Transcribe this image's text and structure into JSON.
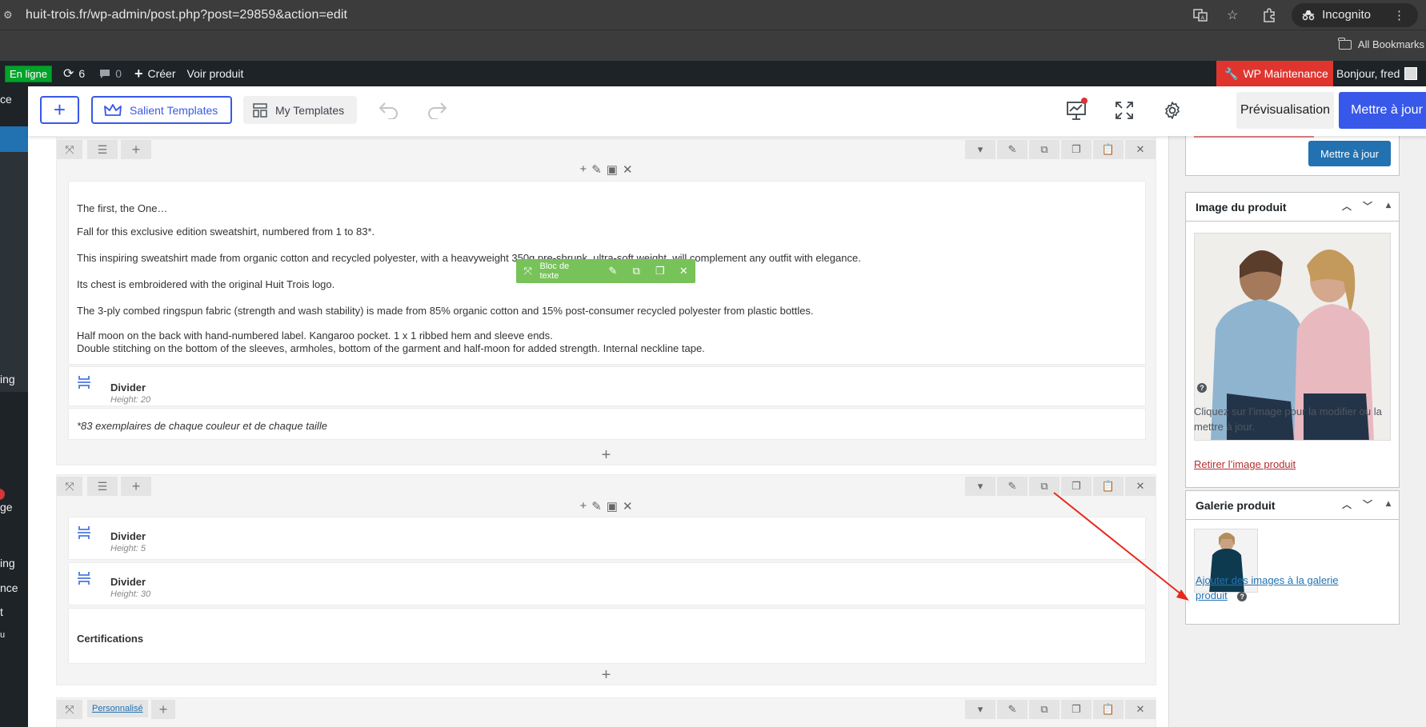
{
  "browser": {
    "url": "huit-trois.fr/wp-admin/post.php?post=29859&action=edit",
    "incognito_label": "Incognito",
    "bookmarks_label": "All Bookmarks"
  },
  "adminbar": {
    "status": "En ligne",
    "updates_count": "6",
    "comments_count": "0",
    "create_label": "Créer",
    "view_label": "Voir produit",
    "maintenance_label": "WP Maintenance",
    "greeting": "Bonjour, fred"
  },
  "wpmenu": {
    "fragments": [
      "ce",
      "ing",
      "ge",
      "ing",
      "nce",
      "t",
      "u"
    ]
  },
  "toolbar": {
    "salient_label": "Salient Templates",
    "my_templates_label": "My Templates",
    "preview_label": "Prévisualisation",
    "update_label": "Mettre à jour"
  },
  "editor": {
    "text_block": [
      "The first, the One…",
      "Fall for this exclusive edition sweatshirt, numbered from 1 to 83*.",
      "This inspiring sweatshirt made from organic cotton and recycled polyester, with a heavyweight 350g pre-shrunk, ultra-soft weight, will complement any outfit with elegance.",
      "Its chest is embroidered with the original Huit Trois logo.",
      "The 3-ply combed ringspun fabric (strength and wash stability) is made from 85% organic cotton and 15% post-consumer recycled polyester from plastic bottles.",
      "Half moon on the back with hand-numbered label. Kangaroo pocket. 1 x 1 ribbed hem and sleeve ends.",
      "Double stitching on the bottom of the sleeves, armholes, bottom of the garment and half-moon for added strength. Internal neckline tape."
    ],
    "floating_bar_label": "Bloc de texte",
    "divider1": {
      "name": "Divider",
      "sub": "Height: 20"
    },
    "note": "*83 exemplaires de chaque couleur et de chaque taille",
    "divider2": {
      "name": "Divider",
      "sub": "Height: 5"
    },
    "divider3": {
      "name": "Divider",
      "sub": "Height: 30"
    },
    "certifications": "Certifications",
    "row3_badge": "Personnalisé"
  },
  "sidebar": {
    "update_label": "Mettre à jour",
    "product_image": {
      "title": "Image du produit",
      "help_text": "Cliquez sur l’image pour la modifier ou la mettre à jour.",
      "remove_link": "Retirer l’image produit"
    },
    "gallery": {
      "title": "Galerie produit",
      "add_link_line1": "Ajouter des images à la galerie",
      "add_link_line2": "produit"
    }
  },
  "colors": {
    "accent_blue": "#3858e9",
    "wp_blue": "#2271b1",
    "maintenance_red": "#e0352f",
    "online_green": "#00a32a",
    "element_bar_green": "#78c25a",
    "arrow_red": "#e8281e"
  }
}
